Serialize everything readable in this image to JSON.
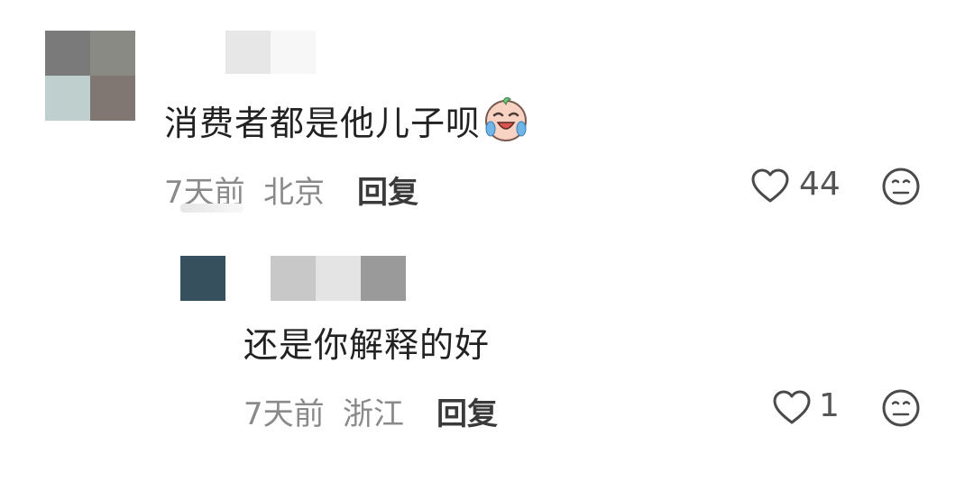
{
  "comments": [
    {
      "text": "消费者都是他儿子呗",
      "emoji": "crying-baby-emoji",
      "time": "7天前",
      "location": "北京",
      "reply_label": "回复",
      "likes": "44"
    },
    {
      "text": "还是你解释的好",
      "time": "7天前",
      "location": "浙江",
      "reply_label": "回复",
      "likes": "1"
    }
  ],
  "icons": {
    "like": "heart-outline-icon",
    "dislike": "neutral-face-icon"
  },
  "colors": {
    "text": "#222222",
    "meta": "#8a8a8a",
    "icon": "#4a4a4a"
  }
}
